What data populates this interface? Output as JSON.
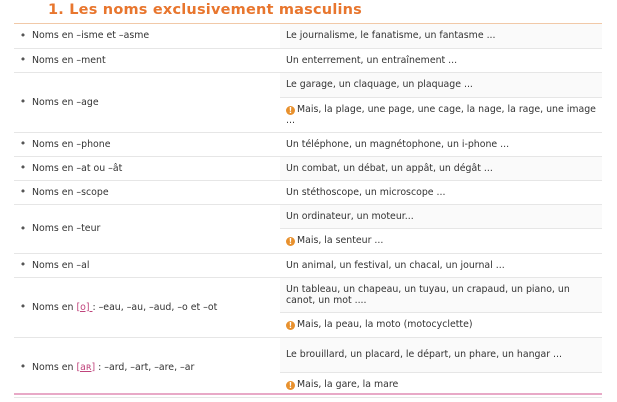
{
  "title": "1. Les noms exclusivement masculins",
  "rows": [
    {
      "bullet": "•",
      "left": "Noms en –isme  et –asme",
      "right": [
        "Le journalisme, le fanatisme, un fantasme ..."
      ]
    },
    {
      "bullet": "•",
      "left": "Noms en –ment",
      "right": [
        "Un enterrement, un entraînement ..."
      ]
    },
    {
      "bullet": "•",
      "left": "Noms en –age",
      "right": [
        "Le garage, un claquage, un plaquage ...",
        "Mais, la plage, une page, une cage, la nage, la rage, une image ..."
      ]
    },
    {
      "bullet": "•",
      "left": "Noms en –phone",
      "right": [
        "Un téléphone, un magnétophone, un i-phone ..."
      ]
    },
    {
      "bullet": "•",
      "left": "Noms en –at  ou –ât",
      "right": [
        "Un combat, un débat, un appât, un dégât ..."
      ]
    },
    {
      "bullet": "•",
      "left": "Noms en –scope",
      "right": [
        "Un stéthoscope, un microscope ..."
      ]
    },
    {
      "bullet": "•",
      "left": "Noms en –teur",
      "right": [
        "Un ordinateur, un moteur...",
        "Mais, la senteur ..."
      ]
    },
    {
      "bullet": "•",
      "left": "Noms en –al",
      "right": [
        "Un animal, un festival, un chacal, un journal ..."
      ]
    },
    {
      "bullet": "•",
      "left_pre": "Noms en ",
      "left_phon": "[o] ",
      "left_post": ": –eau, –au, –aud, –o et –ot",
      "right": [
        "Un tableau, un chapeau, un tuyau, un crapaud, un piano, un canot, un mot ....",
        "Mais, la peau, la moto (motocyclette)"
      ]
    },
    {
      "bullet": "•",
      "left_pre": "Noms en ",
      "left_phon": "[aʀ]",
      "left_post": " : –ard, –art, –are, –ar",
      "right": [
        "Le brouillard, un placard, le départ, un phare, un hangar ...",
        "Mais, la gare, la mare"
      ]
    }
  ],
  "warning_icon": "exclamation-circle-icon",
  "colors": {
    "title": "#e8762e",
    "warning": "#e8912e",
    "phonetic": "#c0447c",
    "bottom_rule": "#e8a9c7"
  }
}
